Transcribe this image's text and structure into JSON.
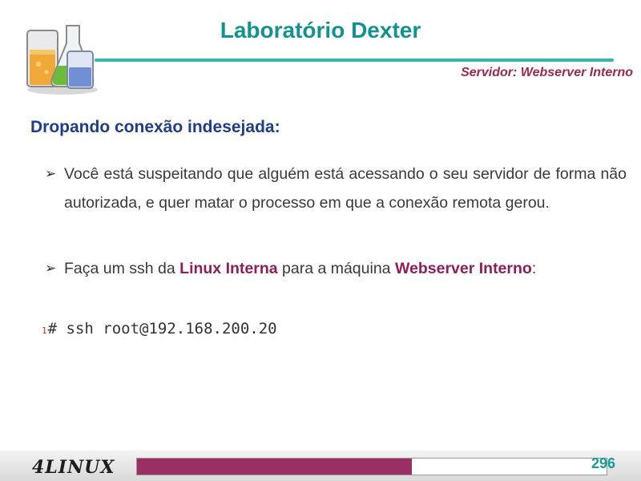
{
  "slide": {
    "title": "Laboratório Dexter",
    "subtitle": "Servidor: Webserver Interno",
    "heading": "Dropando conexão indesejada:",
    "bullets": [
      {
        "text": "Você está suspeitando que alguém está acessando o seu servidor de forma não autorizada, e quer matar o processo em que a conexão remota gerou."
      },
      {
        "before": "Faça um ssh da ",
        "hl1": "Linux Interna",
        "middle": " para a máquina ",
        "hl2": "Webserver Interno",
        "after": ":"
      }
    ],
    "code": {
      "line_number": "1",
      "text": "# ssh root@192.168.200.20"
    }
  },
  "footer": {
    "brand": "4LINUX",
    "page_number": "296",
    "progress_fraction": 0.586
  },
  "colors": {
    "title": "#13938f",
    "subtitle": "#a0284f",
    "heading": "#1e3d8a",
    "highlight": "#8e1f5c",
    "progress": "#9a2f62"
  },
  "icons": {
    "logo": "lab-flasks-icon",
    "bullet": "arrow-bullet-icon"
  }
}
